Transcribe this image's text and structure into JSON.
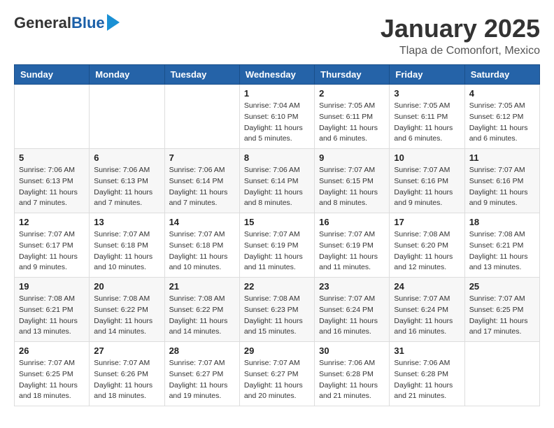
{
  "logo": {
    "general": "General",
    "blue": "Blue"
  },
  "title": "January 2025",
  "subtitle": "Tlapa de Comonfort, Mexico",
  "weekdays": [
    "Sunday",
    "Monday",
    "Tuesday",
    "Wednesday",
    "Thursday",
    "Friday",
    "Saturday"
  ],
  "weeks": [
    [
      {
        "day": "",
        "info": ""
      },
      {
        "day": "",
        "info": ""
      },
      {
        "day": "",
        "info": ""
      },
      {
        "day": "1",
        "sunrise": "7:04 AM",
        "sunset": "6:10 PM",
        "daylight": "11 hours and 5 minutes."
      },
      {
        "day": "2",
        "sunrise": "7:05 AM",
        "sunset": "6:11 PM",
        "daylight": "11 hours and 6 minutes."
      },
      {
        "day": "3",
        "sunrise": "7:05 AM",
        "sunset": "6:11 PM",
        "daylight": "11 hours and 6 minutes."
      },
      {
        "day": "4",
        "sunrise": "7:05 AM",
        "sunset": "6:12 PM",
        "daylight": "11 hours and 6 minutes."
      }
    ],
    [
      {
        "day": "5",
        "sunrise": "7:06 AM",
        "sunset": "6:13 PM",
        "daylight": "11 hours and 7 minutes."
      },
      {
        "day": "6",
        "sunrise": "7:06 AM",
        "sunset": "6:13 PM",
        "daylight": "11 hours and 7 minutes."
      },
      {
        "day": "7",
        "sunrise": "7:06 AM",
        "sunset": "6:14 PM",
        "daylight": "11 hours and 7 minutes."
      },
      {
        "day": "8",
        "sunrise": "7:06 AM",
        "sunset": "6:14 PM",
        "daylight": "11 hours and 8 minutes."
      },
      {
        "day": "9",
        "sunrise": "7:07 AM",
        "sunset": "6:15 PM",
        "daylight": "11 hours and 8 minutes."
      },
      {
        "day": "10",
        "sunrise": "7:07 AM",
        "sunset": "6:16 PM",
        "daylight": "11 hours and 9 minutes."
      },
      {
        "day": "11",
        "sunrise": "7:07 AM",
        "sunset": "6:16 PM",
        "daylight": "11 hours and 9 minutes."
      }
    ],
    [
      {
        "day": "12",
        "sunrise": "7:07 AM",
        "sunset": "6:17 PM",
        "daylight": "11 hours and 9 minutes."
      },
      {
        "day": "13",
        "sunrise": "7:07 AM",
        "sunset": "6:18 PM",
        "daylight": "11 hours and 10 minutes."
      },
      {
        "day": "14",
        "sunrise": "7:07 AM",
        "sunset": "6:18 PM",
        "daylight": "11 hours and 10 minutes."
      },
      {
        "day": "15",
        "sunrise": "7:07 AM",
        "sunset": "6:19 PM",
        "daylight": "11 hours and 11 minutes."
      },
      {
        "day": "16",
        "sunrise": "7:07 AM",
        "sunset": "6:19 PM",
        "daylight": "11 hours and 11 minutes."
      },
      {
        "day": "17",
        "sunrise": "7:08 AM",
        "sunset": "6:20 PM",
        "daylight": "11 hours and 12 minutes."
      },
      {
        "day": "18",
        "sunrise": "7:08 AM",
        "sunset": "6:21 PM",
        "daylight": "11 hours and 13 minutes."
      }
    ],
    [
      {
        "day": "19",
        "sunrise": "7:08 AM",
        "sunset": "6:21 PM",
        "daylight": "11 hours and 13 minutes."
      },
      {
        "day": "20",
        "sunrise": "7:08 AM",
        "sunset": "6:22 PM",
        "daylight": "11 hours and 14 minutes."
      },
      {
        "day": "21",
        "sunrise": "7:08 AM",
        "sunset": "6:22 PM",
        "daylight": "11 hours and 14 minutes."
      },
      {
        "day": "22",
        "sunrise": "7:08 AM",
        "sunset": "6:23 PM",
        "daylight": "11 hours and 15 minutes."
      },
      {
        "day": "23",
        "sunrise": "7:07 AM",
        "sunset": "6:24 PM",
        "daylight": "11 hours and 16 minutes."
      },
      {
        "day": "24",
        "sunrise": "7:07 AM",
        "sunset": "6:24 PM",
        "daylight": "11 hours and 16 minutes."
      },
      {
        "day": "25",
        "sunrise": "7:07 AM",
        "sunset": "6:25 PM",
        "daylight": "11 hours and 17 minutes."
      }
    ],
    [
      {
        "day": "26",
        "sunrise": "7:07 AM",
        "sunset": "6:25 PM",
        "daylight": "11 hours and 18 minutes."
      },
      {
        "day": "27",
        "sunrise": "7:07 AM",
        "sunset": "6:26 PM",
        "daylight": "11 hours and 18 minutes."
      },
      {
        "day": "28",
        "sunrise": "7:07 AM",
        "sunset": "6:27 PM",
        "daylight": "11 hours and 19 minutes."
      },
      {
        "day": "29",
        "sunrise": "7:07 AM",
        "sunset": "6:27 PM",
        "daylight": "11 hours and 20 minutes."
      },
      {
        "day": "30",
        "sunrise": "7:06 AM",
        "sunset": "6:28 PM",
        "daylight": "11 hours and 21 minutes."
      },
      {
        "day": "31",
        "sunrise": "7:06 AM",
        "sunset": "6:28 PM",
        "daylight": "11 hours and 21 minutes."
      },
      {
        "day": "",
        "info": ""
      }
    ]
  ]
}
